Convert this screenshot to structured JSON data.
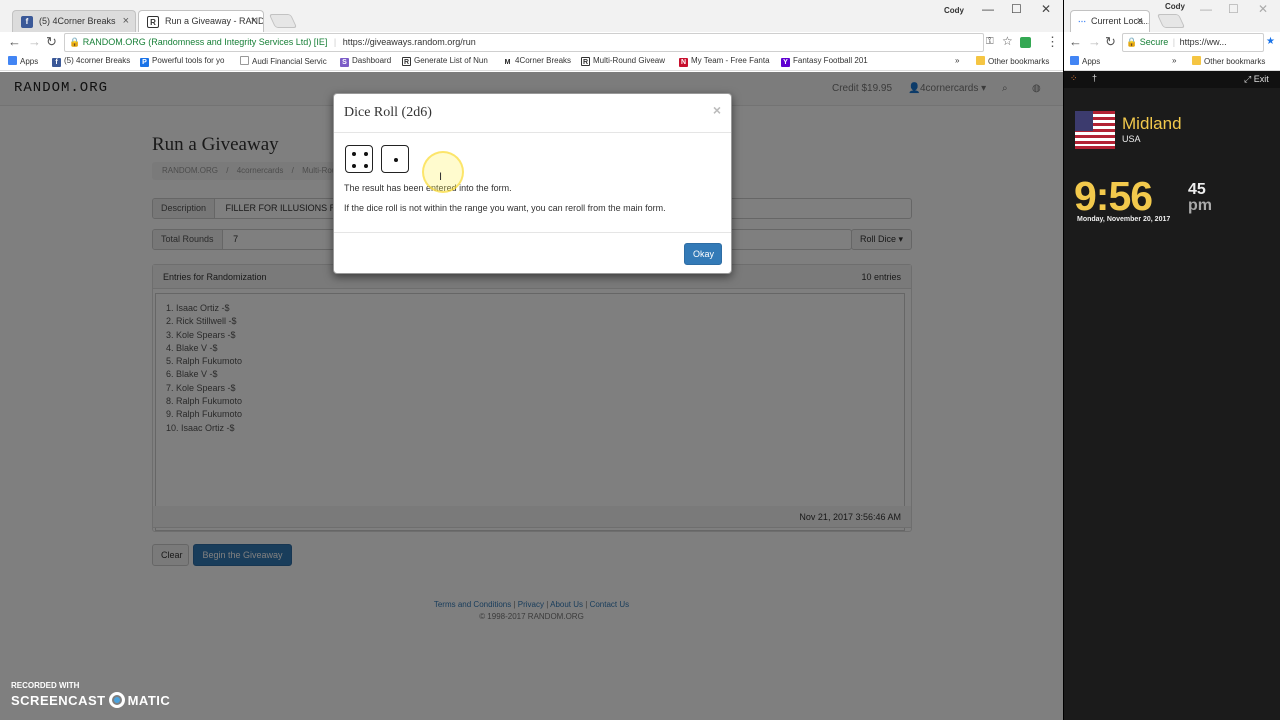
{
  "browser": {
    "tabs": [
      {
        "label": "(5) 4Corner Breaks",
        "favicon": "f"
      },
      {
        "label": "Run a Giveaway - RAND...",
        "favicon": "R"
      }
    ],
    "profile_name": "Cody",
    "address": {
      "site_identity": "RANDOM.ORG (Randomness and Integrity Services Ltd) [IE]",
      "url": "https://giveaways.random.org/run"
    },
    "bookmarks": [
      {
        "label": "Apps"
      },
      {
        "label": "(5) 4corner Breaks"
      },
      {
        "label": "Powerful tools for yo"
      },
      {
        "label": "Audi Financial Servic"
      },
      {
        "label": "Dashboard"
      },
      {
        "label": "Generate List of Nun"
      },
      {
        "label": "4Corner Breaks"
      },
      {
        "label": "Multi-Round Giveaw"
      },
      {
        "label": "My Team - Free Fanta"
      },
      {
        "label": "Fantasy Football 201"
      }
    ],
    "bookmarks_overflow": "»",
    "other_bookmarks": "Other bookmarks"
  },
  "site": {
    "logo": "RANDOM.ORG",
    "credit": "Credit $19.95",
    "account": "4cornercards ▾",
    "page_title": "Run a Giveaway",
    "breadcrumb": [
      "RANDOM.ORG",
      "/",
      "4cornercards",
      "/",
      "Multi-Roun"
    ],
    "description_label": "Description",
    "description_value": "FILLER FOR ILLUSIONS RA",
    "rounds_label": "Total Rounds",
    "rounds_value": "7",
    "roll_dice_label": "Roll Dice ▾",
    "entries_heading": "Entries for Randomization",
    "entries_count": "10 entries",
    "entries": [
      "1. Isaac Ortiz -$",
      "2. Rick Stillwell -$",
      "3. Kole Spears -$",
      "4. Blake V -$",
      "5. Ralph Fukumoto",
      "6. Blake V -$",
      "7. Kole Spears -$",
      "8. Ralph Fukumoto",
      "9. Ralph Fukumoto",
      "10. Isaac Ortiz -$"
    ],
    "timestamp": "Nov 21, 2017 3:56:46 AM",
    "clear_label": "Clear",
    "begin_label": "Begin the Giveaway",
    "footer_links": [
      "Terms and Conditions",
      "|",
      "Privacy",
      "|",
      "About Us",
      "|",
      "Contact Us"
    ],
    "copyright": "© 1998-2017 RANDOM.ORG"
  },
  "modal": {
    "title": "Dice Roll (2d6)",
    "close_glyph": "×",
    "dice": [
      4,
      1
    ],
    "line1": "The result has been entered into the form.",
    "line2": "If the dice roll is not within the range you want, you can reroll from the main form.",
    "ok_label": "Okay"
  },
  "side_window": {
    "tab_label": "Current Loca...",
    "profile_name": "Cody",
    "secure_label": "Secure",
    "url": "https://ww...",
    "apps_label": "Apps",
    "bookmarks_overflow": "»",
    "other_bookmarks": "Other bookmarks",
    "exit_label": "Exit",
    "city": "Midland",
    "country": "USA",
    "time": "9:56",
    "seconds": "45",
    "ampm": "pm",
    "date": "Monday, November 20, 2017"
  },
  "watermark": {
    "line1": "RECORDED WITH",
    "brand_left": "SCREENCAST",
    "brand_right": "MATIC"
  },
  "colors": {
    "primary": "#337ab7",
    "clock_accent": "#f2c94c",
    "secure_green": "#188038"
  }
}
